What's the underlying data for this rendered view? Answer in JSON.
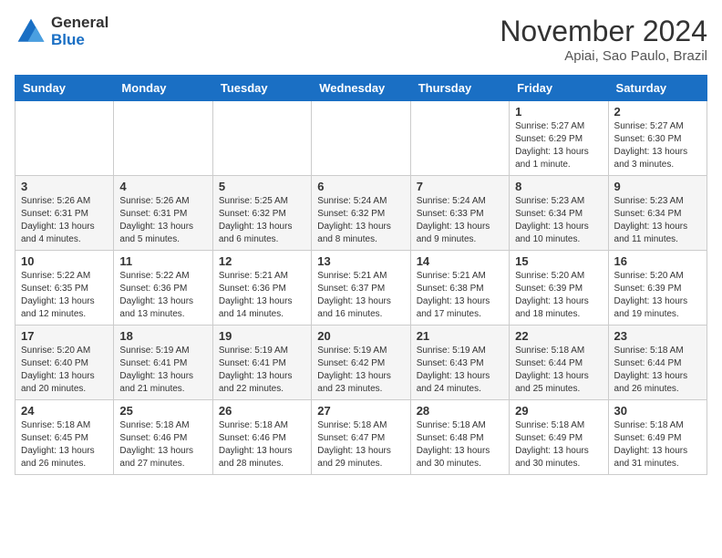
{
  "logo": {
    "general": "General",
    "blue": "Blue"
  },
  "header": {
    "month": "November 2024",
    "location": "Apiai, Sao Paulo, Brazil"
  },
  "days_of_week": [
    "Sunday",
    "Monday",
    "Tuesday",
    "Wednesday",
    "Thursday",
    "Friday",
    "Saturday"
  ],
  "weeks": [
    [
      {
        "day": "",
        "info": ""
      },
      {
        "day": "",
        "info": ""
      },
      {
        "day": "",
        "info": ""
      },
      {
        "day": "",
        "info": ""
      },
      {
        "day": "",
        "info": ""
      },
      {
        "day": "1",
        "info": "Sunrise: 5:27 AM\nSunset: 6:29 PM\nDaylight: 13 hours and 1 minute."
      },
      {
        "day": "2",
        "info": "Sunrise: 5:27 AM\nSunset: 6:30 PM\nDaylight: 13 hours and 3 minutes."
      }
    ],
    [
      {
        "day": "3",
        "info": "Sunrise: 5:26 AM\nSunset: 6:31 PM\nDaylight: 13 hours and 4 minutes."
      },
      {
        "day": "4",
        "info": "Sunrise: 5:26 AM\nSunset: 6:31 PM\nDaylight: 13 hours and 5 minutes."
      },
      {
        "day": "5",
        "info": "Sunrise: 5:25 AM\nSunset: 6:32 PM\nDaylight: 13 hours and 6 minutes."
      },
      {
        "day": "6",
        "info": "Sunrise: 5:24 AM\nSunset: 6:32 PM\nDaylight: 13 hours and 8 minutes."
      },
      {
        "day": "7",
        "info": "Sunrise: 5:24 AM\nSunset: 6:33 PM\nDaylight: 13 hours and 9 minutes."
      },
      {
        "day": "8",
        "info": "Sunrise: 5:23 AM\nSunset: 6:34 PM\nDaylight: 13 hours and 10 minutes."
      },
      {
        "day": "9",
        "info": "Sunrise: 5:23 AM\nSunset: 6:34 PM\nDaylight: 13 hours and 11 minutes."
      }
    ],
    [
      {
        "day": "10",
        "info": "Sunrise: 5:22 AM\nSunset: 6:35 PM\nDaylight: 13 hours and 12 minutes."
      },
      {
        "day": "11",
        "info": "Sunrise: 5:22 AM\nSunset: 6:36 PM\nDaylight: 13 hours and 13 minutes."
      },
      {
        "day": "12",
        "info": "Sunrise: 5:21 AM\nSunset: 6:36 PM\nDaylight: 13 hours and 14 minutes."
      },
      {
        "day": "13",
        "info": "Sunrise: 5:21 AM\nSunset: 6:37 PM\nDaylight: 13 hours and 16 minutes."
      },
      {
        "day": "14",
        "info": "Sunrise: 5:21 AM\nSunset: 6:38 PM\nDaylight: 13 hours and 17 minutes."
      },
      {
        "day": "15",
        "info": "Sunrise: 5:20 AM\nSunset: 6:39 PM\nDaylight: 13 hours and 18 minutes."
      },
      {
        "day": "16",
        "info": "Sunrise: 5:20 AM\nSunset: 6:39 PM\nDaylight: 13 hours and 19 minutes."
      }
    ],
    [
      {
        "day": "17",
        "info": "Sunrise: 5:20 AM\nSunset: 6:40 PM\nDaylight: 13 hours and 20 minutes."
      },
      {
        "day": "18",
        "info": "Sunrise: 5:19 AM\nSunset: 6:41 PM\nDaylight: 13 hours and 21 minutes."
      },
      {
        "day": "19",
        "info": "Sunrise: 5:19 AM\nSunset: 6:41 PM\nDaylight: 13 hours and 22 minutes."
      },
      {
        "day": "20",
        "info": "Sunrise: 5:19 AM\nSunset: 6:42 PM\nDaylight: 13 hours and 23 minutes."
      },
      {
        "day": "21",
        "info": "Sunrise: 5:19 AM\nSunset: 6:43 PM\nDaylight: 13 hours and 24 minutes."
      },
      {
        "day": "22",
        "info": "Sunrise: 5:18 AM\nSunset: 6:44 PM\nDaylight: 13 hours and 25 minutes."
      },
      {
        "day": "23",
        "info": "Sunrise: 5:18 AM\nSunset: 6:44 PM\nDaylight: 13 hours and 26 minutes."
      }
    ],
    [
      {
        "day": "24",
        "info": "Sunrise: 5:18 AM\nSunset: 6:45 PM\nDaylight: 13 hours and 26 minutes."
      },
      {
        "day": "25",
        "info": "Sunrise: 5:18 AM\nSunset: 6:46 PM\nDaylight: 13 hours and 27 minutes."
      },
      {
        "day": "26",
        "info": "Sunrise: 5:18 AM\nSunset: 6:46 PM\nDaylight: 13 hours and 28 minutes."
      },
      {
        "day": "27",
        "info": "Sunrise: 5:18 AM\nSunset: 6:47 PM\nDaylight: 13 hours and 29 minutes."
      },
      {
        "day": "28",
        "info": "Sunrise: 5:18 AM\nSunset: 6:48 PM\nDaylight: 13 hours and 30 minutes."
      },
      {
        "day": "29",
        "info": "Sunrise: 5:18 AM\nSunset: 6:49 PM\nDaylight: 13 hours and 30 minutes."
      },
      {
        "day": "30",
        "info": "Sunrise: 5:18 AM\nSunset: 6:49 PM\nDaylight: 13 hours and 31 minutes."
      }
    ]
  ]
}
